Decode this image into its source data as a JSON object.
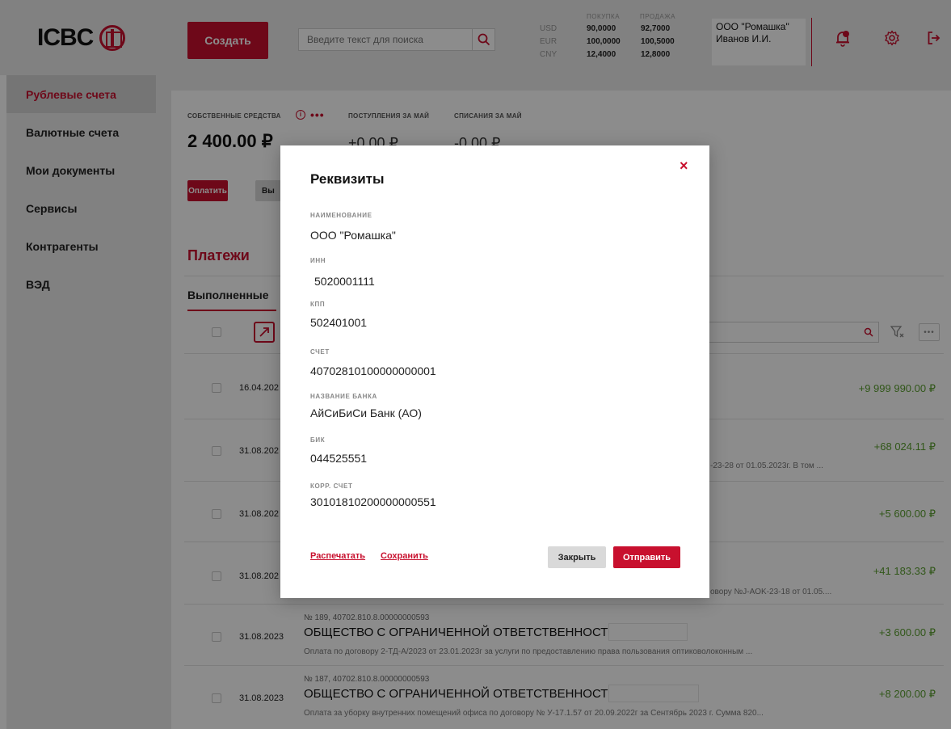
{
  "header": {
    "logo_text": "ICBC",
    "create_label": "Создать",
    "search_placeholder": "Введите текст для поиска",
    "rates": {
      "buy_label": "ПОКУПКА",
      "sell_label": "ПРОДАЖА",
      "rows": [
        {
          "currency": "USD",
          "buy": "90,0000",
          "sell": "92,7000"
        },
        {
          "currency": "EUR",
          "buy": "100,0000",
          "sell": "100,5000"
        },
        {
          "currency": "CNY",
          "buy": "12,4000",
          "sell": "12,8000"
        }
      ]
    },
    "org_name": "ООО \"Ромашка\"",
    "user_name": "Иванов И.И."
  },
  "sidebar": {
    "items": [
      {
        "label": "Рублевые счета",
        "active": true
      },
      {
        "label": "Валютные счета"
      },
      {
        "label": "Мои документы"
      },
      {
        "label": "Сервисы"
      },
      {
        "label": "Контрагенты"
      },
      {
        "label": "ВЭД"
      }
    ]
  },
  "summary": {
    "own_funds_label": "СОБСТВЕННЫЕ СРЕДСТВА",
    "own_funds_value": "2 400.00 ₽",
    "income_label": "ПОСТУПЛЕНИЯ ЗА МАЙ",
    "income_value": "+0.00 ₽",
    "expense_label": "СПИСАНИЯ ЗА МАЙ",
    "expense_value": "-0.00 ₽",
    "pay_label": "Оплатить",
    "second_btn_label": "Вы"
  },
  "payments": {
    "title": "Платежи",
    "tab_done": "Выполненные",
    "rows": [
      {
        "date": "16.04.202",
        "sum": "+9 999 990.00 ₽"
      },
      {
        "date": "31.08.202",
        "sum": "+68 024.11 ₽",
        "desc": "-23-28 от 01.05.2023г. В том ..."
      },
      {
        "date": "31.08.202",
        "sum": "+5 600.00 ₽"
      },
      {
        "date": "31.08.202",
        "sum": "+41 183.33 ₽",
        "desc": "овору №J-AOK-23-18 от 01.05...."
      },
      {
        "date": "31.08.2023",
        "sum": "+3 600.00 ₽",
        "meta": "№ 189, 40702.810.8.00000000593",
        "title": "ОБЩЕСТВО С ОГРАНИЧЕННОЙ ОТВЕТСТВЕННОСТЬЮ",
        "desc": "Оплата по договору 2-ТД-А/2023 от 23.01.2023г за услуги по предоставлению права пользования оптиковолоконным ..."
      },
      {
        "date": "31.08.2023",
        "sum": "+8 200.00 ₽",
        "meta": "№ 187, 40702.810.8.00000000593",
        "title": "ОБЩЕСТВО С ОГРАНИЧЕННОЙ ОТВЕТСТВЕННОСТЬЮ",
        "desc": "Оплата за уборку внутренних помещений офиса по договору № У-17.1.57 от 20.09.2022г за Сентябрь 2023 г. Сумма 820..."
      }
    ]
  },
  "modal": {
    "title": "Реквизиты",
    "close_symbol": "×",
    "fields": [
      {
        "label": "НАИМЕНОВАНИЕ",
        "value": "ООО \"Ромашка\""
      },
      {
        "label": "ИНН",
        "value": "5020001111"
      },
      {
        "label": "КПП",
        "value": "502401001"
      },
      {
        "label": "СЧЕТ",
        "value": "40702810100000000001"
      },
      {
        "label": "НАЗВАНИЕ БАНКА",
        "value": "АйСиБиСи Банк (АО)"
      },
      {
        "label": "БИК",
        "value": "044525551"
      },
      {
        "label": "КОРР. СЧЕТ",
        "value": "30101810200000000551"
      }
    ],
    "print_label": "Распечатать",
    "save_label": "Сохранить",
    "close_label": "Закрыть",
    "send_label": "Отправить"
  },
  "colors": {
    "brand_red": "#c8102e",
    "positive_green": "#5a9e2f"
  }
}
